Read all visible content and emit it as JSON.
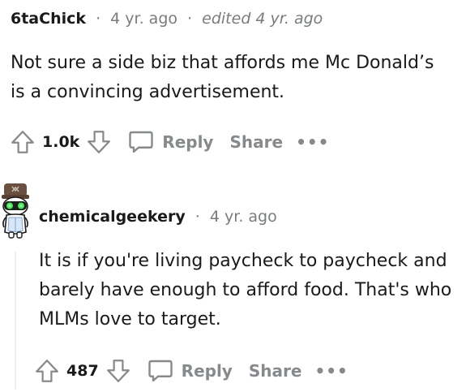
{
  "comments": [
    {
      "username": "6taChick",
      "separator": "·",
      "timestamp": "4 yr. ago",
      "edited": "edited 4 yr. ago",
      "body": "Not sure a side biz that affords me Mc Donald’s is a convincing advertisement.",
      "score": "1.0k",
      "reply_label": "Reply",
      "share_label": "Share",
      "more_label": "•••"
    },
    {
      "username": "chemicalgeekery",
      "separator": "·",
      "timestamp": "4 yr. ago",
      "body": "It is if you're living paycheck to paycheck and barely have enough to afford food. That's who MLMs love to target.",
      "score": "487",
      "reply_label": "Reply",
      "share_label": "Share",
      "more_label": "•••"
    }
  ],
  "icons": {
    "upvote": "upvote-icon",
    "downvote": "downvote-icon",
    "reply": "speech-bubble-icon",
    "avatar": "snoo-avatar"
  },
  "colors": {
    "text": "#1a1a1b",
    "meta": "#787c7e",
    "action": "#878a8c",
    "thread_line": "#edeff1"
  }
}
